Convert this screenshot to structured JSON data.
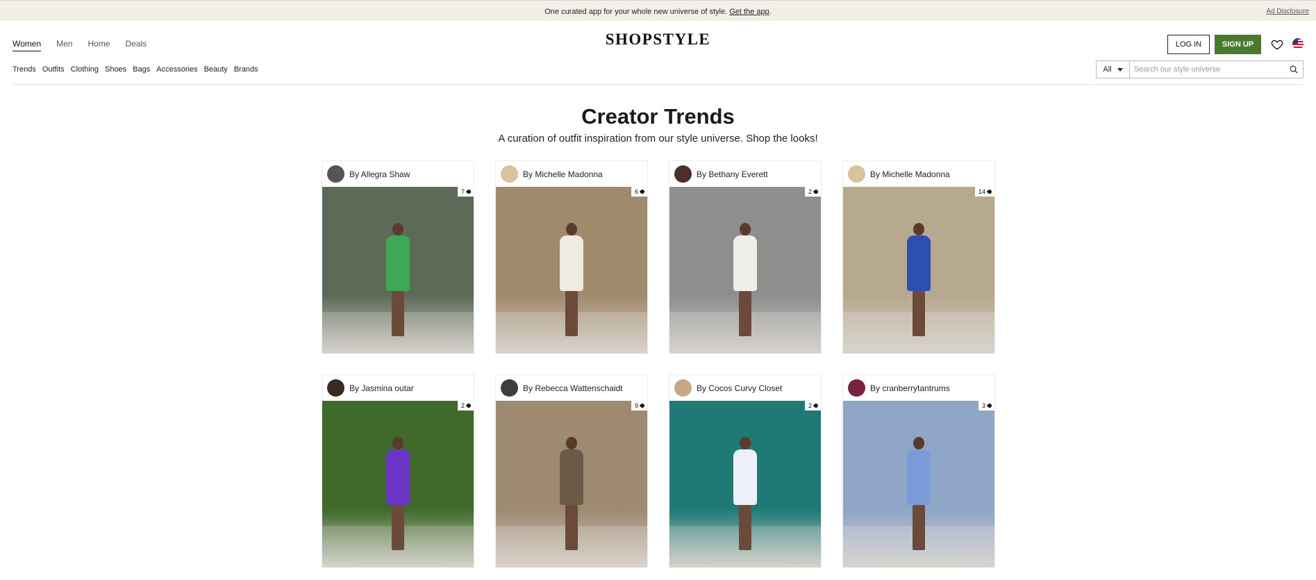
{
  "promo": {
    "text": "One curated app for your whole new universe of style.",
    "link": "Get the app",
    "suffix": ".",
    "ad_disclosure": "Ad Disclosure"
  },
  "gender_nav": [
    "Women",
    "Men",
    "Home",
    "Deals"
  ],
  "logo": "SHOPSTYLE",
  "header": {
    "login_label": "LOG IN",
    "signup_label": "SIGN UP",
    "icons": [
      "heart-icon",
      "us-flag-icon"
    ],
    "accent_color": "#4a7a2c"
  },
  "category_nav": [
    "Trends",
    "Outfits",
    "Clothing",
    "Shoes",
    "Bags",
    "Accessories",
    "Beauty",
    "Brands"
  ],
  "search": {
    "category": "All",
    "placeholder": "Search our style universe",
    "icon": "search-icon"
  },
  "main": {
    "title": "Creator Trends",
    "subtitle": "A curation of outfit inspiration from our style universe. Shop the looks!"
  },
  "cards": [
    {
      "creator": "By Allegra Shaw",
      "count": "7",
      "bg": "#5d6a58",
      "accent": "#3fa852",
      "avatar": "#555555"
    },
    {
      "creator": "By Michelle Madonna",
      "count": "6",
      "bg": "#a08a6c",
      "accent": "#efeae2",
      "avatar": "#d8c39a"
    },
    {
      "creator": "By Bethany Everett",
      "count": "2",
      "bg": "#8e8e8e",
      "accent": "#f0eee8",
      "avatar": "#4a3028"
    },
    {
      "creator": "By Michelle Madonna",
      "count": "14",
      "bg": "#b7a98f",
      "accent": "#2c4fb0",
      "avatar": "#d8c39a"
    },
    {
      "creator": "By Jasmina outar",
      "count": "2",
      "bg": "#3f6a2c",
      "accent": "#6b35c6",
      "avatar": "#3c2a22"
    },
    {
      "creator": "By Rebecca Wattenschaidt",
      "count": "9",
      "bg": "#9e8a70",
      "accent": "#6b5a48",
      "avatar": "#3e3e3e"
    },
    {
      "creator": "By Cocos Curvy Closet",
      "count": "2",
      "bg": "#1f7a76",
      "accent": "#eef0f8",
      "avatar": "#c8a888"
    },
    {
      "creator": "By cranberrytantrums",
      "count": "3",
      "bg": "#8fa6c7",
      "accent": "#7a9ad8",
      "avatar": "#7a2040"
    }
  ]
}
